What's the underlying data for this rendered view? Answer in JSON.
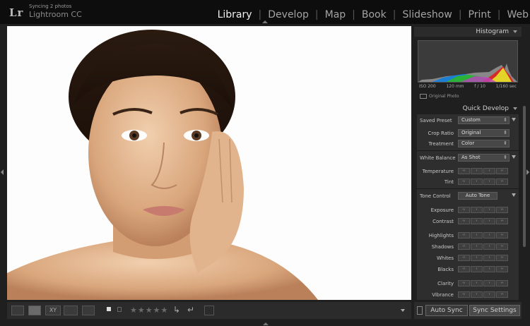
{
  "app": {
    "logo": "Lr",
    "status": "Syncing 2 photos",
    "product": "Lightroom CC"
  },
  "modules": [
    {
      "label": "Library",
      "active": true
    },
    {
      "label": "Develop",
      "active": false
    },
    {
      "label": "Map",
      "active": false
    },
    {
      "label": "Book",
      "active": false
    },
    {
      "label": "Slideshow",
      "active": false
    },
    {
      "label": "Print",
      "active": false
    },
    {
      "label": "Web",
      "active": false
    }
  ],
  "histogram": {
    "title": "Histogram",
    "iso": "ISO 200",
    "focal": "120 mm",
    "aperture": "f / 10",
    "shutter": "1/160 sec",
    "original_photo_label": "Original Photo"
  },
  "quick_develop": {
    "title": "Quick Develop",
    "saved_preset_label": "Saved Preset",
    "saved_preset_value": "Custom",
    "crop_ratio_label": "Crop Ratio",
    "crop_ratio_value": "Original",
    "treatment_label": "Treatment",
    "treatment_value": "Color",
    "white_balance_label": "White Balance",
    "white_balance_value": "As Shot",
    "temperature_label": "Temperature",
    "tint_label": "Tint",
    "tone_control_label": "Tone Control",
    "auto_tone_label": "Auto Tone",
    "exposure_label": "Exposure",
    "contrast_label": "Contrast",
    "highlights_label": "Highlights",
    "shadows_label": "Shadows",
    "whites_label": "Whites",
    "blacks_label": "Blacks",
    "clarity_label": "Clarity",
    "vibrance_label": "Vibrance"
  },
  "bottom": {
    "auto_sync_label": "Auto Sync",
    "sync_settings_label": "Sync Settings",
    "stars": "★★★★★"
  },
  "colors": {
    "accent": "#f0f0f0",
    "panel": "#2e2e2e",
    "topbar": "#0d0d0d"
  }
}
